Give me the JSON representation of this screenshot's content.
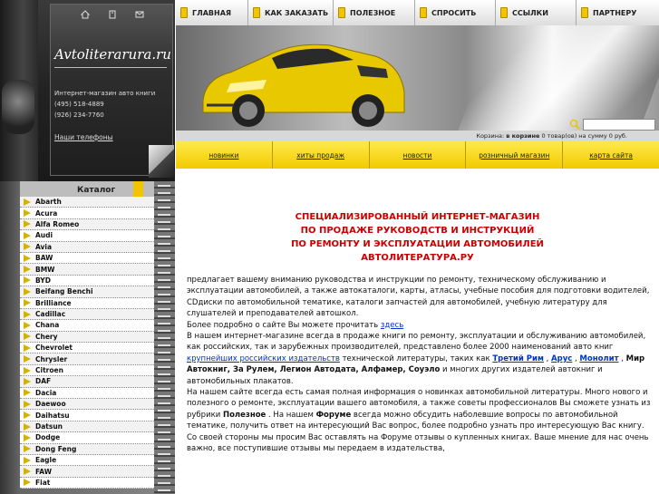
{
  "header": {
    "logo": "Avtoliterarura.ru",
    "subtitle": "Интернет-магазин авто книги",
    "phones": [
      "(495) 518-4889",
      "(926) 234-7760"
    ],
    "phones_link": "Наши телефоны",
    "icons": [
      "home-icon",
      "bookmark-icon",
      "mail-icon"
    ]
  },
  "top_nav": [
    {
      "label": "ГЛАВНАЯ"
    },
    {
      "label": "КАК ЗАКАЗАТЬ"
    },
    {
      "label": "ПОЛЕЗНОЕ"
    },
    {
      "label": "СПРОСИТЬ"
    },
    {
      "label": "ССЫЛКИ"
    },
    {
      "label": "ПАРТНЕРУ"
    }
  ],
  "cart": {
    "prefix": "Корзина:",
    "bold": "в корзине",
    "rest": "0 товар(ов) на сумму 0 руб."
  },
  "sub_nav": [
    {
      "label": "новинки"
    },
    {
      "label": "хиты продаж"
    },
    {
      "label": "новости"
    },
    {
      "label": "розничный магазин"
    },
    {
      "label": "карта сайта"
    }
  ],
  "catalog": {
    "title": "Каталог",
    "items": [
      "Abarth",
      "Acura",
      "Alfa Romeo",
      "Audi",
      "Avia",
      "BAW",
      "BMW",
      "BYD",
      "Beifang Benchi",
      "Brilliance",
      "Cadillac",
      "Chana",
      "Chery",
      "Chevrolet",
      "Chrysler",
      "Citroen",
      "DAF",
      "Dacia",
      "Daewoo",
      "Daihatsu",
      "Datsun",
      "Dodge",
      "Dong Feng",
      "Eagle",
      "FAW",
      "Fiat"
    ]
  },
  "main": {
    "headline": [
      "СПЕЦИАЛИЗИРОВАННЫЙ ИНТЕРНЕТ-МАГАЗИН",
      "ПО ПРОДАЖЕ РУКОВОДСТВ И ИНСТРУКЦИЙ",
      "ПО РЕМОНТУ И ЭКСПЛУАТАЦИИ АВТОМОБИЛЕЙ",
      "АВТОЛИТЕРАТУРА.РУ"
    ],
    "p1": "предлагает вашему вниманию руководства и инструкции по ремонту, техническому обслуживанию и эксплуатации автомобилей, а также автокаталоги, карты, атласы, учебные пособия для подготовки водителей,  CDдиски по автомобильной тематике, каталоги запчастей для автомобилей, учебную литературу для слушателей и преподавателей автошкол.",
    "p2_pre": "Более подробно о сайте Вы можете прочитать ",
    "p2_link": "здесь",
    "p3_a": "В нашем интернет-магазине всегда в продаже книги по ремонту, эксплуатации и обслуживанию автомобилей, как российских, так и зарубежных производителей, представлено более  2000 наименований авто книг  ",
    "p3_link1": "крупнейших российских издательств",
    "p3_b": " технической литературы, таких как  ",
    "p3_link2": "Третий Рим",
    "p3_c": " , ",
    "p3_link3": "Арус",
    "p3_d": " , ",
    "p3_link4": "Монолит",
    "p3_e": " , ",
    "p3_bold1": "Мир Автокниг, За Рулем, Легион Автодата, Алфамер, Соуэло",
    "p3_f": "   и многих других издателей автокниг и автомобильных плакатов.",
    "p4_a": "На нашем сайте всегда есть самая полная информация о новинках автомобильной литературы. Много нового и полезного о ремонте, эксплуатации вашего автомобиля, а также советы профессионалов Вы сможете узнать из рубрики ",
    "p4_bold1": "Полезное",
    "p4_b": " . На нашем ",
    "p4_bold2": "Форуме",
    "p4_c": " всегда можно обсудить наболевшие вопросы по автомобильной тематике, получить ответ на интересующий Вас вопрос, более подробно узнать про интересующую Вас книгу.",
    "p5": "Со своей стороны мы просим Вас оставлять на Форуме отзывы о купленных книгах. Ваше мнение для нас очень важно, все поступившие отзывы мы передаем в издательства,"
  },
  "colors": {
    "accent_yellow": "#f2d400",
    "headline_red": "#cc0000",
    "link_blue": "#0033cc"
  }
}
